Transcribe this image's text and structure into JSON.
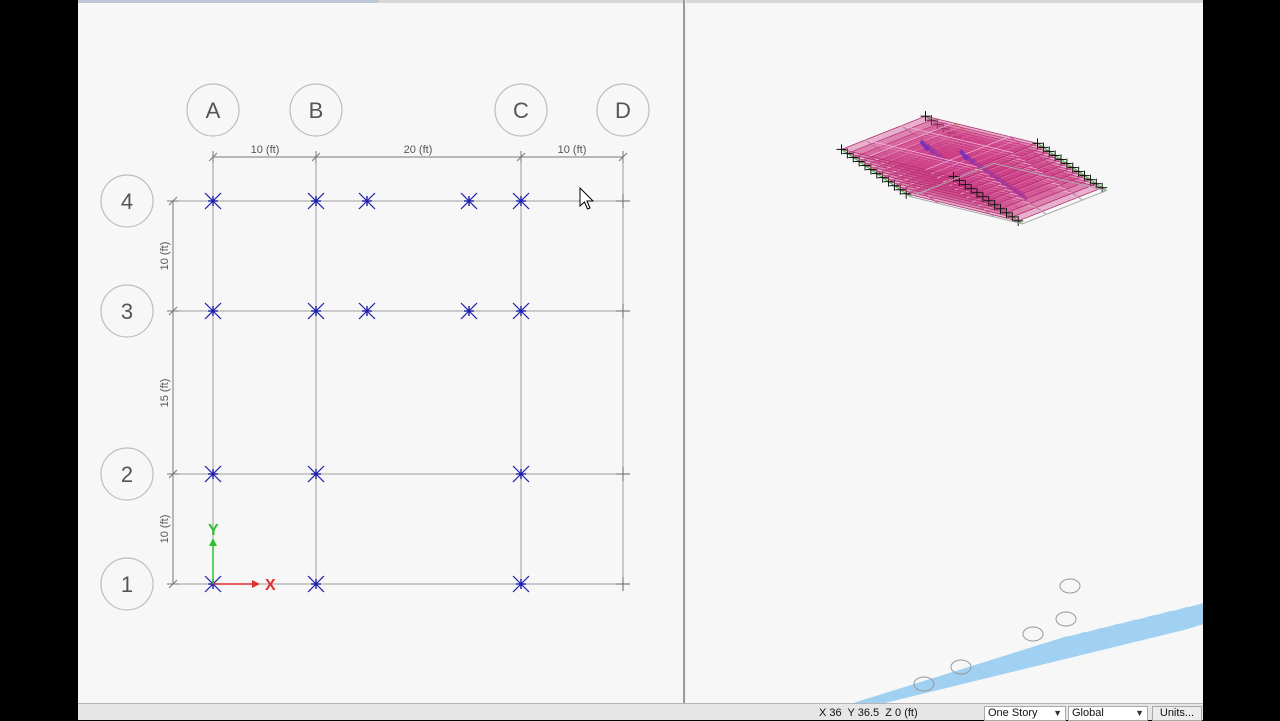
{
  "plan": {
    "column_bubbles": [
      "A",
      "B",
      "C",
      "D"
    ],
    "row_bubbles": [
      "4",
      "3",
      "2",
      "1"
    ],
    "x_dimensions": [
      "10 (ft)",
      "20 (ft)",
      "10 (ft)"
    ],
    "y_dimensions": [
      "10 (ft)",
      "15 (ft)",
      "10 (ft)"
    ],
    "axis_x_label": "X",
    "axis_y_label": "Y"
  },
  "status": {
    "coordinates": "X 36  Y 36.5  Z 0 (ft)",
    "story_option": "One Story",
    "coord_system": "Global",
    "units_label": "Units..."
  },
  "colors": {
    "grid_line": "#9e9e9e",
    "column_marker": "#1a1aa8",
    "slab_fill": "#cc3d85",
    "core_wall": "#8b6b4a",
    "brace": "#6a2fc0",
    "base_grid": "#9fd0f2"
  }
}
